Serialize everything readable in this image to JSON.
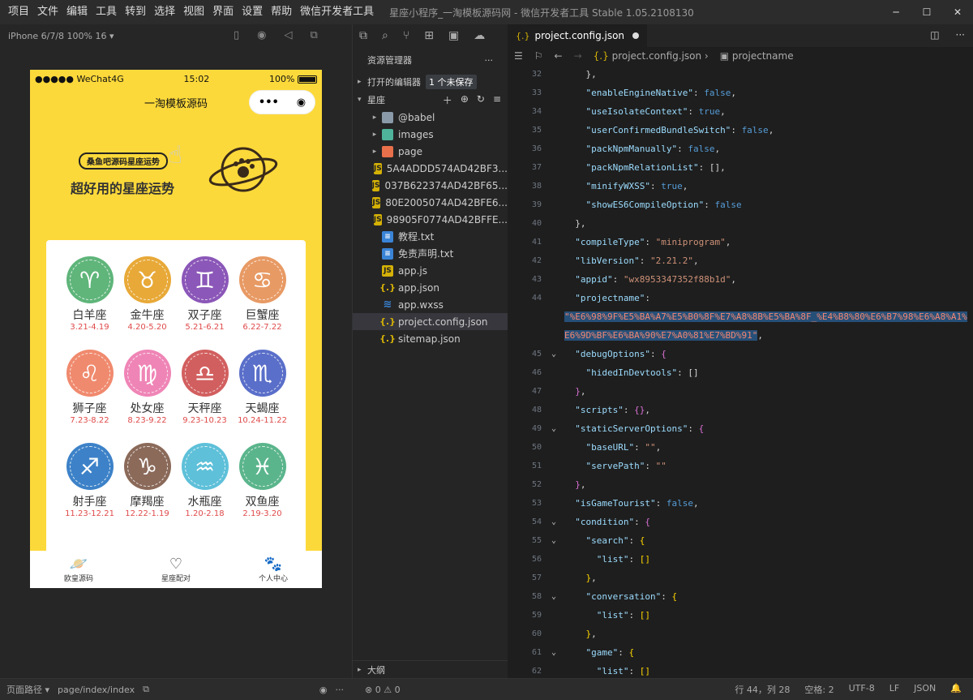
{
  "menu": [
    "项目",
    "文件",
    "编辑",
    "工具",
    "转到",
    "选择",
    "视图",
    "界面",
    "设置",
    "帮助",
    "微信开发者工具"
  ],
  "window_title": "星座小程序_一淘模板源码网 - 微信开发者工具 Stable 1.05.2108130",
  "simulator": {
    "device": "iPhone 6/7/8 100% 16 ▾",
    "status": {
      "carrier": "●●●●● WeChat4G",
      "time": "15:02",
      "battery": "100%"
    },
    "nav_title": "一淘模板源码",
    "capsule_more": "•••",
    "capsule_close": "◉",
    "banner_tag": "桑鱼吧源码星座运势",
    "banner_slogan": "超好用的星座运势",
    "zodiac": [
      {
        "symbol": "♈",
        "name": "白羊座",
        "dates": "3.21-4.19",
        "color": "#5fb57a"
      },
      {
        "symbol": "♉",
        "name": "金牛座",
        "dates": "4.20-5.20",
        "color": "#e8a938"
      },
      {
        "symbol": "♊",
        "name": "双子座",
        "dates": "5.21-6.21",
        "color": "#8b57b8"
      },
      {
        "symbol": "♋",
        "name": "巨蟹座",
        "dates": "6.22-7.22",
        "color": "#e89a64"
      },
      {
        "symbol": "♌",
        "name": "狮子座",
        "dates": "7.23-8.22",
        "color": "#f08a6e"
      },
      {
        "symbol": "♍",
        "name": "处女座",
        "dates": "8.23-9.22",
        "color": "#ef85b6"
      },
      {
        "symbol": "♎",
        "name": "天秤座",
        "dates": "9.23-10.23",
        "color": "#d25f5f"
      },
      {
        "symbol": "♏",
        "name": "天蝎座",
        "dates": "10.24-11.22",
        "color": "#5a6fc9"
      },
      {
        "symbol": "♐",
        "name": "射手座",
        "dates": "11.23-12.21",
        "color": "#3d82c8"
      },
      {
        "symbol": "♑",
        "name": "摩羯座",
        "dates": "12.22-1.19",
        "color": "#8b6a5a"
      },
      {
        "symbol": "♒",
        "name": "水瓶座",
        "dates": "1.20-2.18",
        "color": "#5ec0d9"
      },
      {
        "symbol": "♓",
        "name": "双鱼座",
        "dates": "2.19-3.20",
        "color": "#5bb58c"
      }
    ],
    "tabs": [
      {
        "icon": "🪐",
        "label": "欧皇源码"
      },
      {
        "icon": "♡",
        "label": "星座配对"
      },
      {
        "icon": "🐾",
        "label": "个人中心"
      }
    ]
  },
  "explorer": {
    "title": "资源管理器",
    "more": "···",
    "open_editors": "打开的编辑器",
    "unsaved": "1 个未保存",
    "project": "星座",
    "files": [
      {
        "name": "@babel",
        "type": "folder",
        "arrow": "▸"
      },
      {
        "name": "images",
        "type": "img",
        "arrow": "▸"
      },
      {
        "name": "page",
        "type": "page",
        "arrow": "▸"
      },
      {
        "name": "5A4ADDD574AD42BF3...",
        "type": "js",
        "arrow": ""
      },
      {
        "name": "037B622374AD42BF65...",
        "type": "js",
        "arrow": ""
      },
      {
        "name": "80E2005074AD42BFE6...",
        "type": "js",
        "arrow": ""
      },
      {
        "name": "98905F0774AD42BFFE...",
        "type": "js",
        "arrow": ""
      },
      {
        "name": "教程.txt",
        "type": "txt",
        "arrow": ""
      },
      {
        "name": "免责声明.txt",
        "type": "txt",
        "arrow": ""
      },
      {
        "name": "app.js",
        "type": "js",
        "arrow": ""
      },
      {
        "name": "app.json",
        "type": "json",
        "arrow": ""
      },
      {
        "name": "app.wxss",
        "type": "css",
        "arrow": ""
      },
      {
        "name": "project.config.json",
        "type": "json",
        "arrow": ""
      },
      {
        "name": "sitemap.json",
        "type": "json",
        "arrow": ""
      }
    ],
    "outline": "大纲"
  },
  "editor": {
    "tab": "project.config.json",
    "breadcrumb_file": "project.config.json",
    "breadcrumb_key": "projectname",
    "lines": [
      {
        "n": "32",
        "fold": "",
        "html": "    <span class='p'>},</span>"
      },
      {
        "n": "33",
        "fold": "",
        "html": "    <span class='k'>\"enableEngineNative\"</span><span class='p'>: </span><span class='b'>false</span><span class='p'>,</span>"
      },
      {
        "n": "34",
        "fold": "",
        "html": "    <span class='k'>\"useIsolateContext\"</span><span class='p'>: </span><span class='b'>true</span><span class='p'>,</span>"
      },
      {
        "n": "35",
        "fold": "",
        "html": "    <span class='k'>\"userConfirmedBundleSwitch\"</span><span class='p'>: </span><span class='b'>false</span><span class='p'>,</span>"
      },
      {
        "n": "36",
        "fold": "",
        "html": "    <span class='k'>\"packNpmManually\"</span><span class='p'>: </span><span class='b'>false</span><span class='p'>,</span>"
      },
      {
        "n": "37",
        "fold": "",
        "html": "    <span class='k'>\"packNpmRelationList\"</span><span class='p'>: [],</span>"
      },
      {
        "n": "38",
        "fold": "",
        "html": "    <span class='k'>\"minifyWXSS\"</span><span class='p'>: </span><span class='b'>true</span><span class='p'>,</span>"
      },
      {
        "n": "39",
        "fold": "",
        "html": "    <span class='k'>\"showES6CompileOption\"</span><span class='p'>: </span><span class='b'>false</span>"
      },
      {
        "n": "40",
        "fold": "",
        "html": "  <span class='p'>},</span>"
      },
      {
        "n": "41",
        "fold": "",
        "html": "  <span class='k'>\"compileType\"</span><span class='p'>: </span><span class='s'>\"miniprogram\"</span><span class='p'>,</span>"
      },
      {
        "n": "42",
        "fold": "",
        "html": "  <span class='k'>\"libVersion\"</span><span class='p'>: </span><span class='s'>\"2.21.2\"</span><span class='p'>,</span>"
      },
      {
        "n": "43",
        "fold": "",
        "html": "  <span class='k'>\"appid\"</span><span class='p'>: </span><span class='s'>\"wx8953347352f88b1d\"</span><span class='p'>,</span>"
      },
      {
        "n": "44",
        "fold": "",
        "html": "  <span class='k'>\"projectname\"</span><span class='p'>:</span>"
      },
      {
        "n": "",
        "fold": "",
        "html": "<span class='hl sel-s'>\"%E6%98%9F%E5%BA%A7%E5%B0%8F%E7%A8%8B%E5%BA%8F_%E4%B8%80%E6%B7%98%E6%A8%A1%</span>"
      },
      {
        "n": "",
        "fold": "",
        "html": "<span class='hl sel-s'>E6%9D%BF%E6%BA%90%E7%A0%81%E7%BD%91\"</span><span class='p'>,</span>"
      },
      {
        "n": "45",
        "fold": "⌄",
        "html": "  <span class='k'>\"debugOptions\"</span><span class='p'>: </span><span class='m'>{</span>"
      },
      {
        "n": "46",
        "fold": "",
        "html": "    <span class='k'>\"hidedInDevtools\"</span><span class='p'>: []</span>"
      },
      {
        "n": "47",
        "fold": "",
        "html": "  <span class='m'>}</span><span class='p'>,</span>"
      },
      {
        "n": "48",
        "fold": "",
        "html": "  <span class='k'>\"scripts\"</span><span class='p'>: </span><span class='m'>{}</span><span class='p'>,</span>"
      },
      {
        "n": "49",
        "fold": "⌄",
        "html": "  <span class='k'>\"staticServerOptions\"</span><span class='p'>: </span><span class='m'>{</span>"
      },
      {
        "n": "50",
        "fold": "",
        "html": "    <span class='k'>\"baseURL\"</span><span class='p'>: </span><span class='s'>\"\"</span><span class='p'>,</span>"
      },
      {
        "n": "51",
        "fold": "",
        "html": "    <span class='k'>\"servePath\"</span><span class='p'>: </span><span class='s'>\"\"</span>"
      },
      {
        "n": "52",
        "fold": "",
        "html": "  <span class='m'>}</span><span class='p'>,</span>"
      },
      {
        "n": "53",
        "fold": "",
        "html": "  <span class='k'>\"isGameTourist\"</span><span class='p'>: </span><span class='b'>false</span><span class='p'>,</span>"
      },
      {
        "n": "54",
        "fold": "⌄",
        "html": "  <span class='k'>\"condition\"</span><span class='p'>: </span><span class='m'>{</span>"
      },
      {
        "n": "55",
        "fold": "⌄",
        "html": "    <span class='k'>\"search\"</span><span class='p'>: </span><span class='y'>{</span>"
      },
      {
        "n": "56",
        "fold": "",
        "html": "      <span class='k'>\"list\"</span><span class='p'>: </span><span class='y'>[]</span>"
      },
      {
        "n": "57",
        "fold": "",
        "html": "    <span class='y'>}</span><span class='p'>,</span>"
      },
      {
        "n": "58",
        "fold": "⌄",
        "html": "    <span class='k'>\"conversation\"</span><span class='p'>: </span><span class='y'>{</span>"
      },
      {
        "n": "59",
        "fold": "",
        "html": "      <span class='k'>\"list\"</span><span class='p'>: </span><span class='y'>[]</span>"
      },
      {
        "n": "60",
        "fold": "",
        "html": "    <span class='y'>}</span><span class='p'>,</span>"
      },
      {
        "n": "61",
        "fold": "⌄",
        "html": "    <span class='k'>\"game\"</span><span class='p'>: </span><span class='y'>{</span>"
      },
      {
        "n": "62",
        "fold": "",
        "html": "      <span class='k'>\"list\"</span><span class='p'>: </span><span class='y'>[]</span>"
      }
    ]
  },
  "statusbar": {
    "page_path_label": "页面路径 ▾",
    "page_path": "page/index/index",
    "problems": "⊗ 0 ⚠ 0",
    "position": "行 44，列 28",
    "spaces": "空格: 2",
    "encoding": "UTF-8",
    "eol": "LF",
    "language": "JSON"
  }
}
